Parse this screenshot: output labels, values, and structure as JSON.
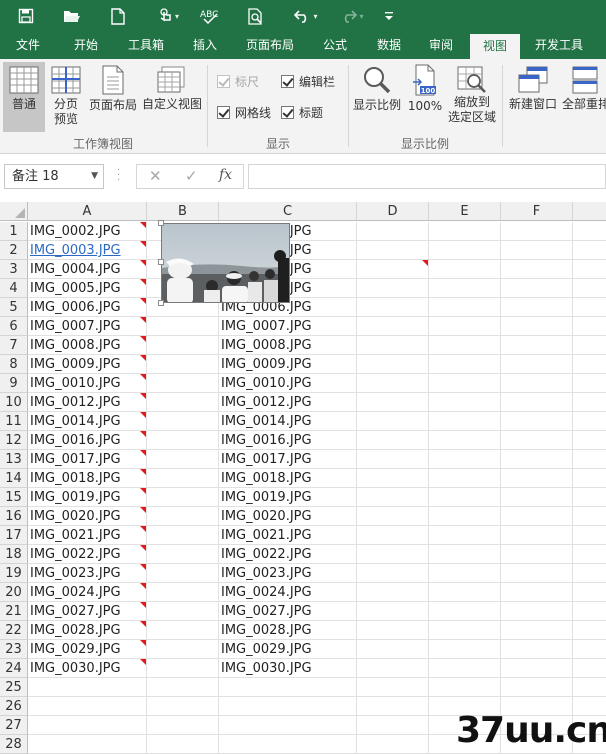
{
  "tabs": [
    "文件",
    "开始",
    "工具箱",
    "插入",
    "页面布局",
    "公式",
    "数据",
    "审阅",
    "视图",
    "开发工具"
  ],
  "active_tab": "视图",
  "ribbon": {
    "workbook_views": {
      "label": "工作簿视图",
      "normal": "普通",
      "page_break_line1": "分页",
      "page_break_line2": "预览",
      "page_layout": "页面布局",
      "custom_views": "自定义视图"
    },
    "show": {
      "label": "显示",
      "ruler": "标尺",
      "formula_bar": "编辑栏",
      "gridlines": "网格线",
      "headings": "标题"
    },
    "zoom": {
      "label": "显示比例",
      "zoom": "显示比例",
      "hundred": "100%",
      "hundred_icon_text": "100",
      "zoom_sel_line1": "缩放到",
      "zoom_sel_line2": "选定区域"
    },
    "window": {
      "new_window": "新建窗口",
      "arrange_all": "全部重排"
    }
  },
  "formula_bar": {
    "name_box": "备注 18",
    "cancel": "✕",
    "enter": "✓",
    "fx": "fx",
    "value": ""
  },
  "columns": [
    "A",
    "B",
    "C",
    "D",
    "E",
    "F"
  ],
  "rows": [
    {
      "n": "1",
      "a": "IMG_0002.JPG",
      "c": "IMG_0002.JPG"
    },
    {
      "n": "2",
      "a": "IMG_0003.JPG",
      "c": "IMG_0003.JPG"
    },
    {
      "n": "3",
      "a": "IMG_0004.JPG",
      "c": "IMG_0004.JPG"
    },
    {
      "n": "4",
      "a": "IMG_0005.JPG",
      "c": "IMG_0005.JPG"
    },
    {
      "n": "5",
      "a": "IMG_0006.JPG",
      "c": "IMG_0006.JPG"
    },
    {
      "n": "6",
      "a": "IMG_0007.JPG",
      "c": "IMG_0007.JPG"
    },
    {
      "n": "7",
      "a": "IMG_0008.JPG",
      "c": "IMG_0008.JPG"
    },
    {
      "n": "8",
      "a": "IMG_0009.JPG",
      "c": "IMG_0009.JPG"
    },
    {
      "n": "9",
      "a": "IMG_0010.JPG",
      "c": "IMG_0010.JPG"
    },
    {
      "n": "10",
      "a": "IMG_0012.JPG",
      "c": "IMG_0012.JPG"
    },
    {
      "n": "11",
      "a": "IMG_0014.JPG",
      "c": "IMG_0014.JPG"
    },
    {
      "n": "12",
      "a": "IMG_0016.JPG",
      "c": "IMG_0016.JPG"
    },
    {
      "n": "13",
      "a": "IMG_0017.JPG",
      "c": "IMG_0017.JPG"
    },
    {
      "n": "14",
      "a": "IMG_0018.JPG",
      "c": "IMG_0018.JPG"
    },
    {
      "n": "15",
      "a": "IMG_0019.JPG",
      "c": "IMG_0019.JPG"
    },
    {
      "n": "16",
      "a": "IMG_0020.JPG",
      "c": "IMG_0020.JPG"
    },
    {
      "n": "17",
      "a": "IMG_0021.JPG",
      "c": "IMG_0021.JPG"
    },
    {
      "n": "18",
      "a": "IMG_0022.JPG",
      "c": "IMG_0022.JPG"
    },
    {
      "n": "19",
      "a": "IMG_0023.JPG",
      "c": "IMG_0023.JPG"
    },
    {
      "n": "20",
      "a": "IMG_0024.JPG",
      "c": "IMG_0024.JPG"
    },
    {
      "n": "21",
      "a": "IMG_0027.JPG",
      "c": "IMG_0027.JPG"
    },
    {
      "n": "22",
      "a": "IMG_0028.JPG",
      "c": "IMG_0028.JPG"
    },
    {
      "n": "23",
      "a": "IMG_0029.JPG",
      "c": "IMG_0029.JPG"
    },
    {
      "n": "24",
      "a": "IMG_0030.JPG",
      "c": "IMG_0030.JPG"
    },
    {
      "n": "25",
      "a": "",
      "c": ""
    },
    {
      "n": "26",
      "a": "",
      "c": ""
    },
    {
      "n": "27",
      "a": "",
      "c": ""
    },
    {
      "n": "28",
      "a": "",
      "c": ""
    }
  ],
  "hyperlink_row": "2",
  "watermark": "37uu.cn",
  "colors": {
    "excel_green": "#217346",
    "comment_indicator": "#e11b1b",
    "hyperlink": "#2a6ac4"
  },
  "icons": [
    "save-icon",
    "open-icon",
    "new-file-icon",
    "touch-mode-icon",
    "spellcheck-icon",
    "print-preview-icon",
    "undo-icon",
    "redo-icon",
    "customize-qat-icon"
  ]
}
